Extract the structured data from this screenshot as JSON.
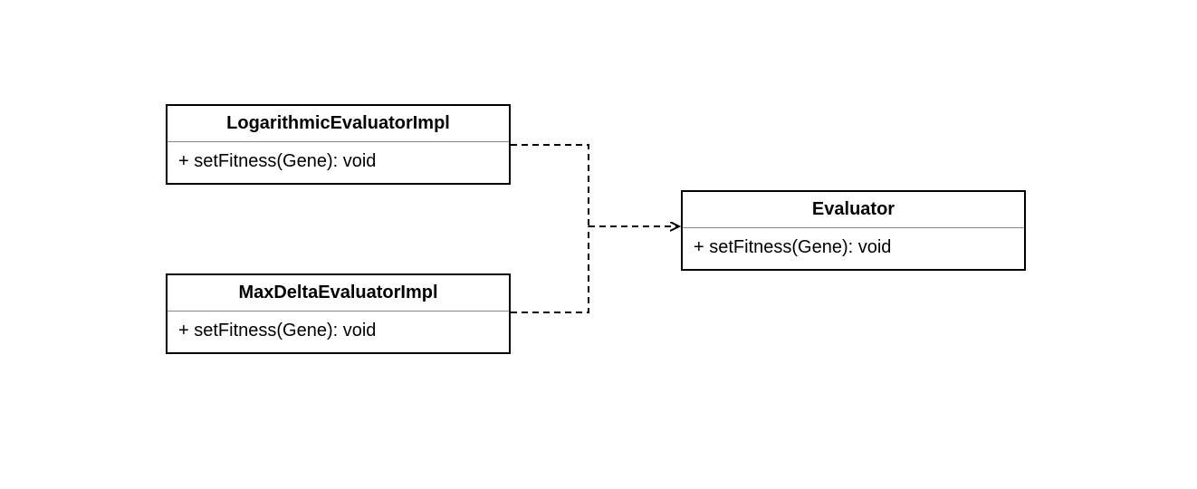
{
  "diagram": {
    "type": "uml-class",
    "classes": {
      "logarithmic": {
        "name": "LogarithmicEvaluatorImpl",
        "methods": [
          "+ setFitness(Gene): void"
        ]
      },
      "maxdelta": {
        "name": "MaxDeltaEvaluatorImpl",
        "methods": [
          "+ setFitness(Gene): void"
        ]
      },
      "evaluator": {
        "name": "Evaluator",
        "methods": [
          "+ setFitness(Gene): void"
        ]
      }
    },
    "relationships": [
      {
        "from": "logarithmic",
        "to": "evaluator",
        "type": "realization"
      },
      {
        "from": "maxdelta",
        "to": "evaluator",
        "type": "realization"
      }
    ]
  }
}
